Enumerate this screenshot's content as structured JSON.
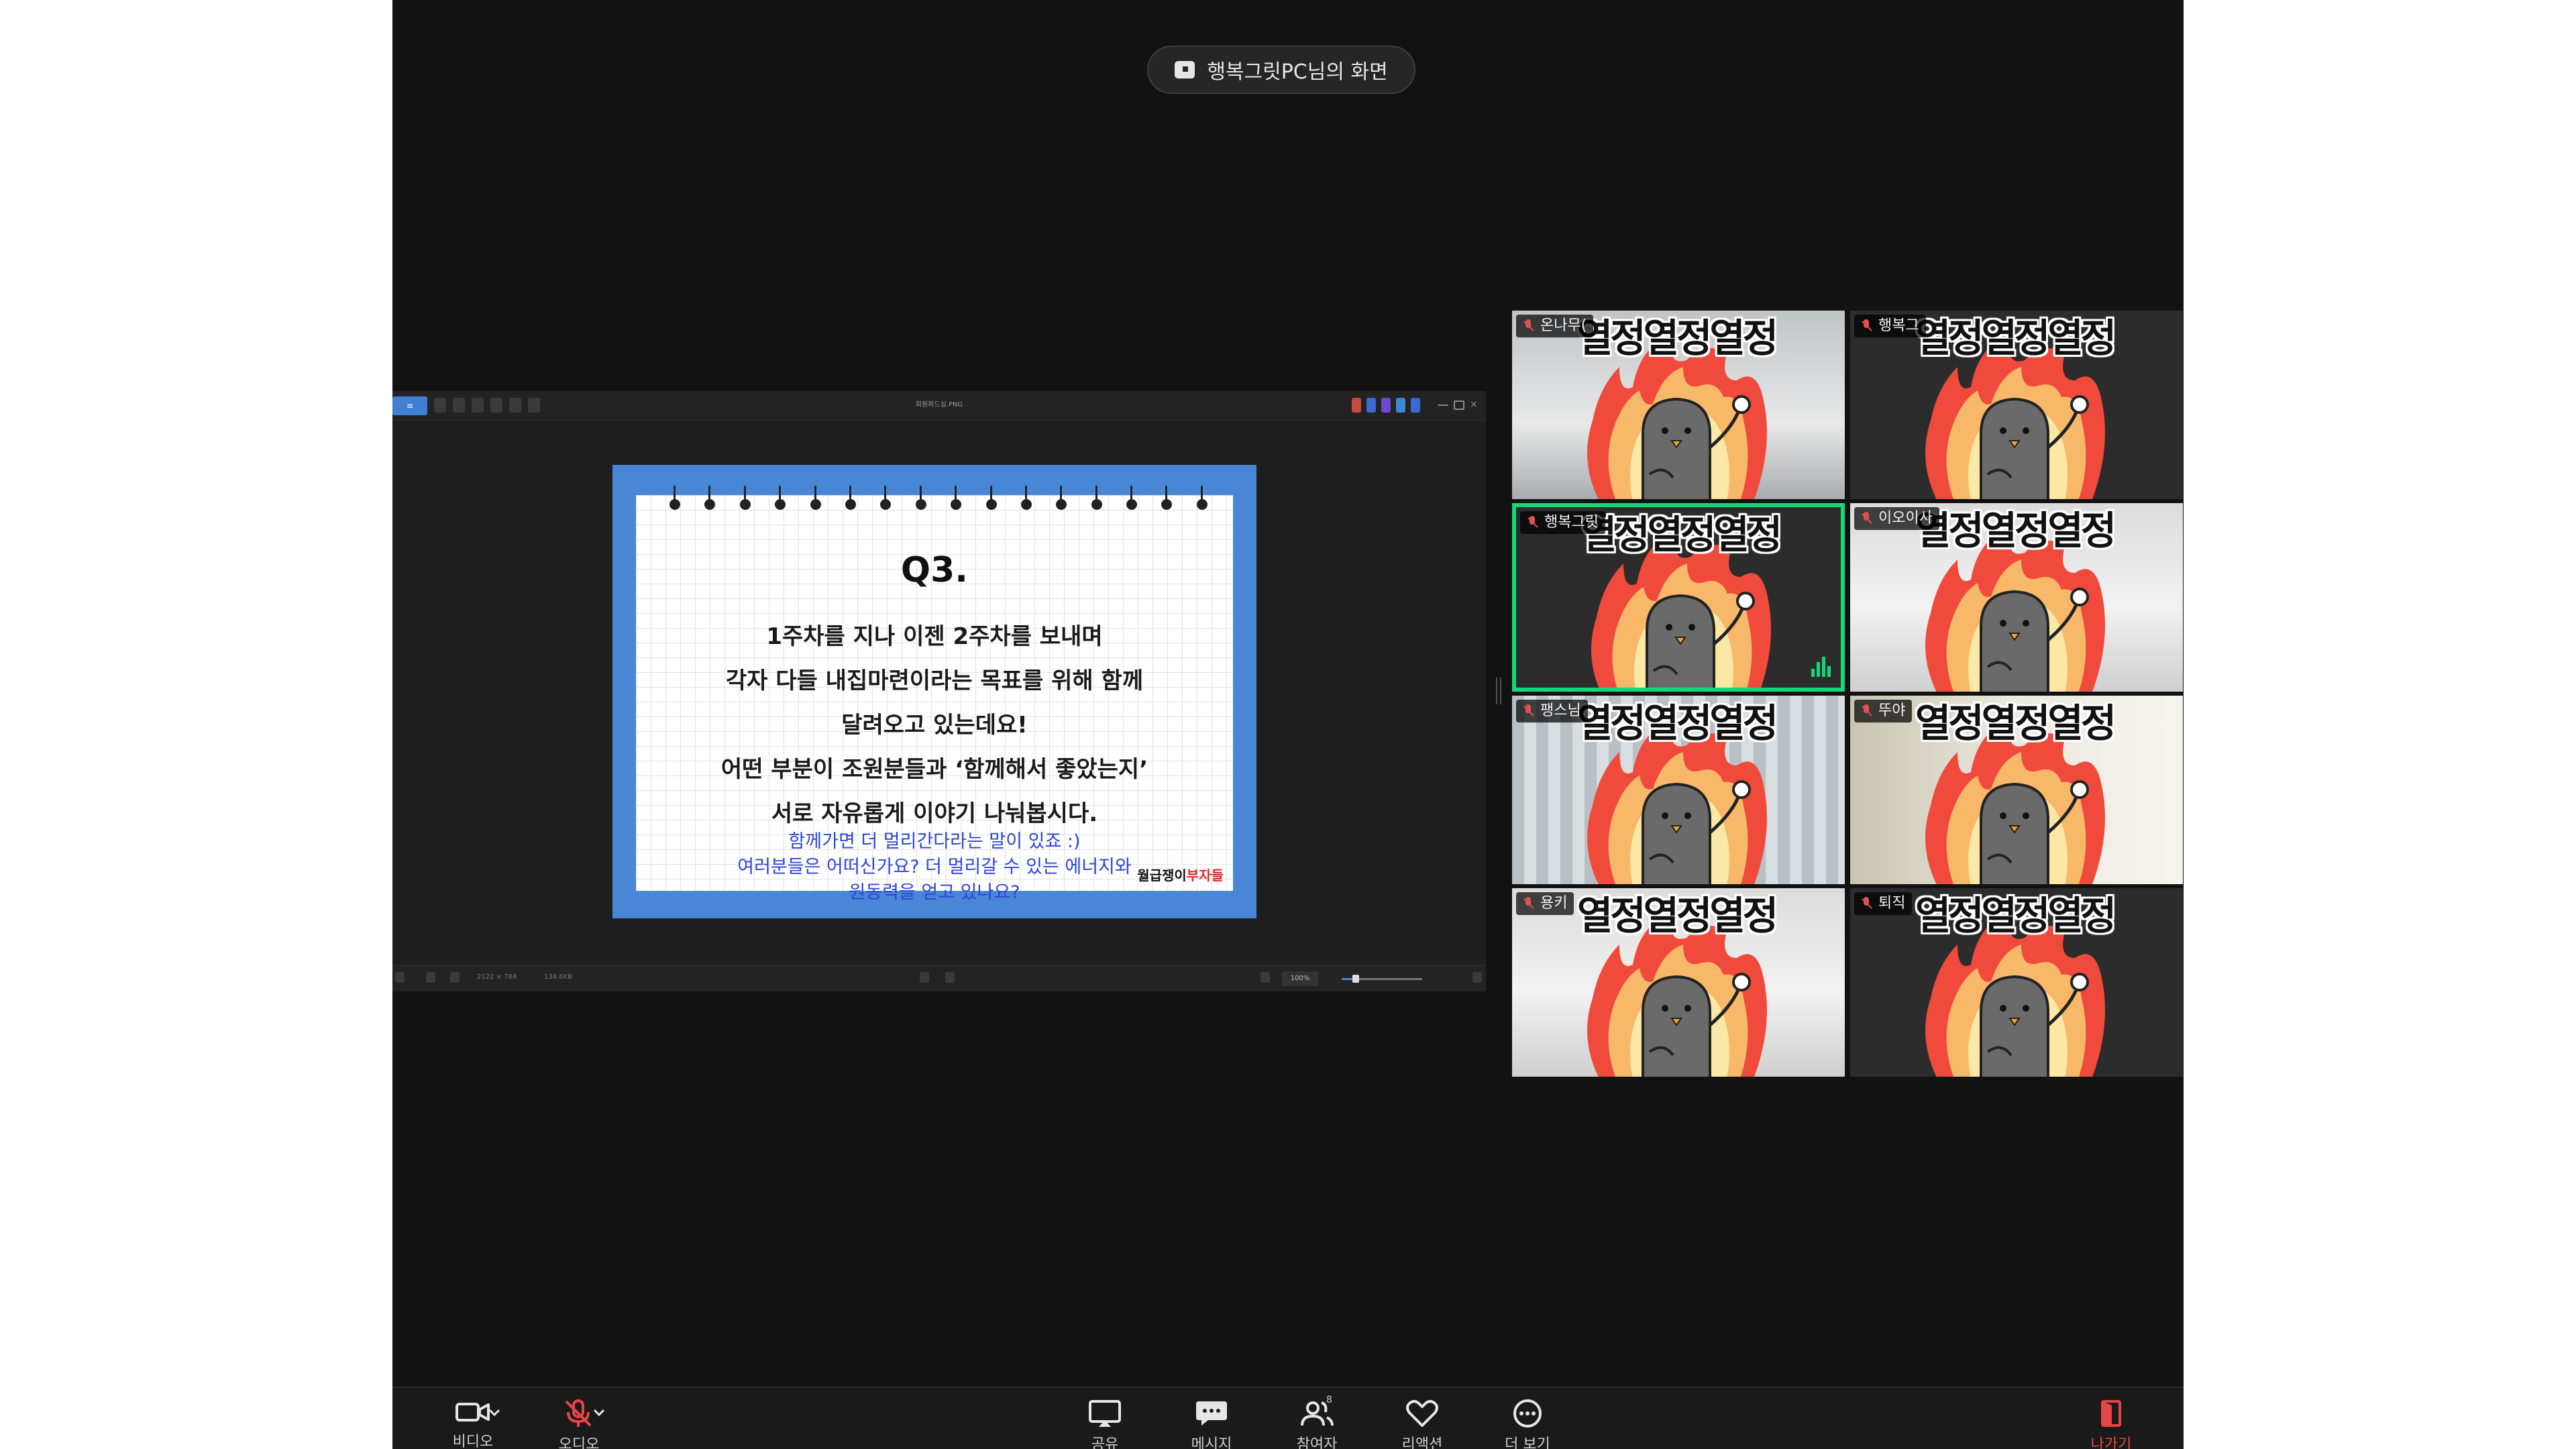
{
  "share_banner": {
    "text": "행복그릿PC님의 화면",
    "icon": "screen-share-icon"
  },
  "viewer": {
    "file_name": "회원퍼드실.PNG",
    "status_left": "2122 × 784",
    "status_size": "134.6KB",
    "zoom": "100%",
    "slide": {
      "title": "Q3.",
      "lines": [
        "1주차를 지나 이젠 2주차를 보내며",
        "각자 다들 내집마련이라는 목표를 위해 함께",
        "달려오고 있는데요!",
        "어떤 부분이 조원분들과 ‘함께해서 좋았는지’",
        "서로 자유롭게 이야기 나눠봅시다."
      ],
      "blue_lines": [
        "함께가면 더 멀리간다라는 말이 있죠 :)",
        "여러분들은 어떠신가요? 더 멀리갈 수 있는 에너지와",
        "원동력을 얻고 있나요?"
      ],
      "brand_black": "월급쟁이",
      "brand_red": "부자들"
    }
  },
  "participants": [
    {
      "name": "온나무(",
      "bg": "win"
    },
    {
      "name": "행복그",
      "bg": "dark"
    },
    {
      "name": "행복그릿",
      "bg": "dark",
      "speaking": true
    },
    {
      "name": "이오이사",
      "bg": "room"
    },
    {
      "name": "팽스님",
      "bg": "curtain"
    },
    {
      "name": "뚜야",
      "bg": "beige"
    },
    {
      "name": "용키",
      "bg": "room"
    },
    {
      "name": "퇴직",
      "bg": "dark"
    }
  ],
  "sticker_text": "열정열정열정",
  "toolbar": {
    "video": {
      "label": "비디오",
      "icon": "camera-icon"
    },
    "audio": {
      "label": "오디오",
      "icon": "mic-muted-icon"
    },
    "share": {
      "label": "공유",
      "icon": "share-screen-icon"
    },
    "chat": {
      "label": "메시지",
      "icon": "chat-icon"
    },
    "participants": {
      "label": "참여자",
      "icon": "participants-icon",
      "count": "8"
    },
    "reactions": {
      "label": "리액션",
      "icon": "heart-icon"
    },
    "more": {
      "label": "더 보기",
      "icon": "more-icon"
    },
    "end": {
      "label": "나가기",
      "icon": "leave-icon"
    }
  },
  "colors": {
    "accent": "#4a86d6",
    "speaking": "#16d77a",
    "end": "#e84646",
    "background": "#121212"
  }
}
